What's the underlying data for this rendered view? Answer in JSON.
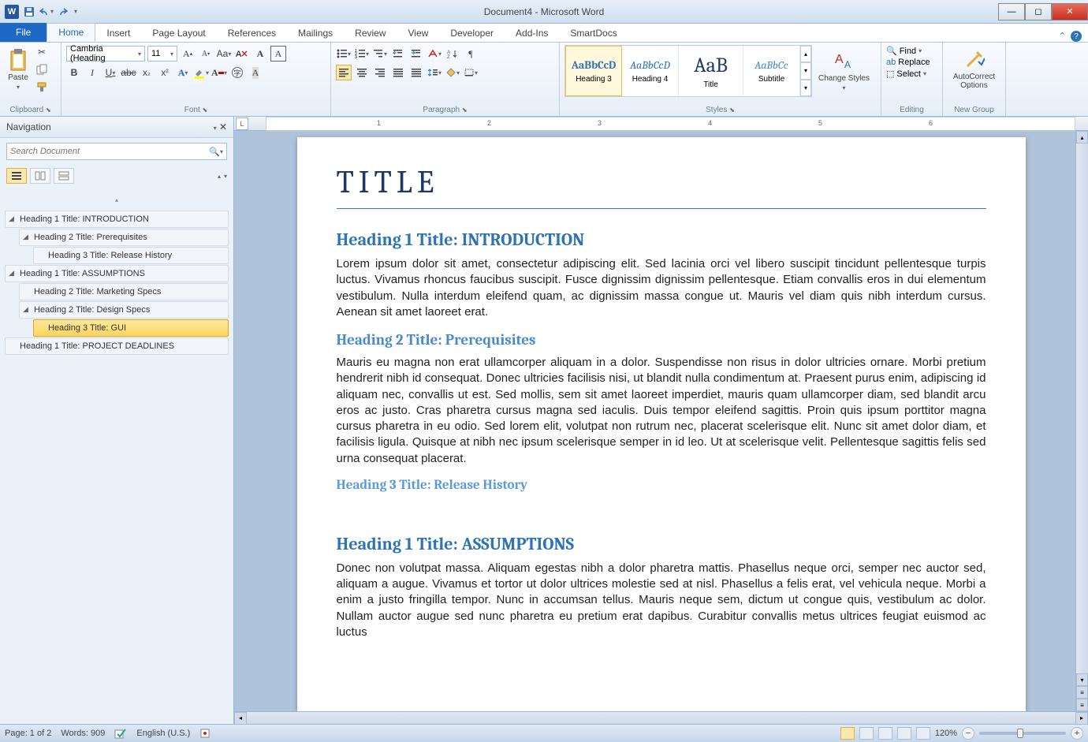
{
  "window": {
    "title": "Document4 - Microsoft Word"
  },
  "qat": {
    "app_letter": "W"
  },
  "tabs": {
    "file": "File",
    "home": "Home",
    "insert": "Insert",
    "pagelayout": "Page Layout",
    "references": "References",
    "mailings": "Mailings",
    "review": "Review",
    "view": "View",
    "developer": "Developer",
    "addins": "Add-Ins",
    "smartdocs": "SmartDocs"
  },
  "ribbon": {
    "clipboard": {
      "label": "Clipboard",
      "paste": "Paste"
    },
    "font": {
      "label": "Font",
      "name": "Cambria (Heading",
      "size": "11"
    },
    "paragraph": {
      "label": "Paragraph"
    },
    "styles": {
      "label": "Styles",
      "items": [
        {
          "preview": "AaBbCcD",
          "name": "Heading 3",
          "color": "#2e74b5",
          "bold": true
        },
        {
          "preview": "AaBbCcD",
          "name": "Heading 4",
          "color": "#2e74b5",
          "italic": true
        },
        {
          "preview": "AaB",
          "name": "Title",
          "color": "#1f3864",
          "big": true
        },
        {
          "preview": "AaBbCc",
          "name": "Subtitle",
          "color": "#4a8ac8",
          "italic": true
        }
      ],
      "change": "Change Styles"
    },
    "editing": {
      "label": "Editing",
      "find": "Find",
      "replace": "Replace",
      "select": "Select"
    },
    "newgroup": {
      "label": "New Group",
      "auto": "AutoCorrect Options"
    }
  },
  "nav": {
    "title": "Navigation",
    "search_placeholder": "Search Document",
    "items": [
      {
        "lvl": 1,
        "exp": true,
        "label": "Heading 1 Title: INTRODUCTION"
      },
      {
        "lvl": 2,
        "exp": true,
        "label": "Heading 2 Title: Prerequisites"
      },
      {
        "lvl": 3,
        "label": "Heading 3 Title: Release History"
      },
      {
        "lvl": 1,
        "exp": true,
        "label": "Heading 1 Title: ASSUMPTIONS"
      },
      {
        "lvl": 2,
        "label": "Heading 2 Title: Marketing Specs"
      },
      {
        "lvl": 2,
        "exp": true,
        "label": "Heading 2 Title: Design Specs"
      },
      {
        "lvl": 3,
        "sel": true,
        "label": "Heading 3 Title: GUI"
      },
      {
        "lvl": 1,
        "label": "Heading 1 Title: PROJECT DEADLINES"
      }
    ]
  },
  "doc": {
    "title": "TITLE",
    "h1a": "Heading 1 Title: INTRODUCTION",
    "p1": "Lorem ipsum dolor sit amet, consectetur adipiscing elit. Sed lacinia orci vel libero suscipit tincidunt pellentesque turpis luctus. Vivamus rhoncus faucibus suscipit. Fusce dignissim dignissim pellentesque. Etiam convallis eros in dui elementum vestibulum. Nulla interdum eleifend quam, ac dignissim massa congue ut. Mauris vel diam quis nibh interdum cursus. Aenean sit amet laoreet erat.",
    "h2a": "Heading 2 Title: Prerequisites",
    "p2": "Mauris eu magna non erat ullamcorper aliquam in a dolor. Suspendisse non risus in dolor ultricies ornare. Morbi pretium hendrerit nibh id consequat. Donec ultricies facilisis nisi, ut blandit nulla condimentum at. Praesent purus enim, adipiscing id aliquam nec, convallis ut est. Sed mollis, sem sit amet laoreet imperdiet, mauris quam ullamcorper diam, sed blandit arcu eros ac justo. Cras pharetra cursus magna sed iaculis. Duis tempor eleifend sagittis. Proin quis ipsum porttitor magna cursus pharetra in eu odio. Sed lorem elit, volutpat non rutrum nec, placerat scelerisque elit. Nunc sit amet dolor diam, et facilisis ligula. Quisque at nibh nec ipsum scelerisque semper in id leo. Ut at scelerisque velit. Pellentesque sagittis felis sed urna consequat placerat.",
    "h3a": "Heading 3 Title: Release History",
    "h1b": "Heading 1 Title: ASSUMPTIONS",
    "p3": "Donec non volutpat massa. Aliquam egestas nibh a dolor pharetra mattis. Phasellus neque orci, semper nec auctor sed, aliquam a augue. Vivamus et tortor ut dolor ultrices molestie sed at nisl. Phasellus a felis erat, vel vehicula neque. Morbi a enim a justo fringilla tempor. Nunc in accumsan tellus. Mauris neque sem, dictum ut congue quis, vestibulum ac dolor. Nullam auctor augue sed nunc pharetra eu pretium erat dapibus. Curabitur convallis metus ultrices feugiat euismod ac luctus"
  },
  "status": {
    "page": "Page: 1 of 2",
    "words": "Words: 909",
    "lang": "English (U.S.)",
    "zoom": "120%"
  },
  "ruler": {
    "marks": [
      "1",
      "2",
      "3",
      "4",
      "5",
      "6"
    ]
  }
}
